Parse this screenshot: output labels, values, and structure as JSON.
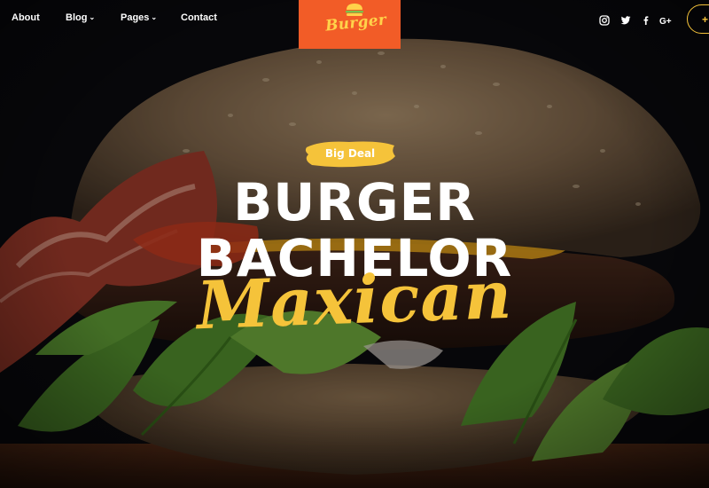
{
  "nav": {
    "items": [
      {
        "label": "About",
        "has_dropdown": false
      },
      {
        "label": "Blog",
        "has_dropdown": true
      },
      {
        "label": "Pages",
        "has_dropdown": true
      },
      {
        "label": "Contact",
        "has_dropdown": false
      }
    ],
    "caret": "⌄"
  },
  "logo": {
    "text": "Burger",
    "icon": "burger-icon",
    "background": "#f25c27",
    "text_color": "#ffd24a"
  },
  "social": [
    {
      "icon": "instagram-icon"
    },
    {
      "icon": "twitter-icon"
    },
    {
      "icon": "facebook-icon"
    },
    {
      "icon": "google-plus-icon"
    }
  ],
  "cta": {
    "label": "+",
    "border_color": "#f5c33a"
  },
  "hero": {
    "badge": "Big Deal",
    "title_line_1": "BURGER",
    "title_line_2": "BACHELOR",
    "script_line": "Maxican",
    "accent": "#f5c33a"
  }
}
